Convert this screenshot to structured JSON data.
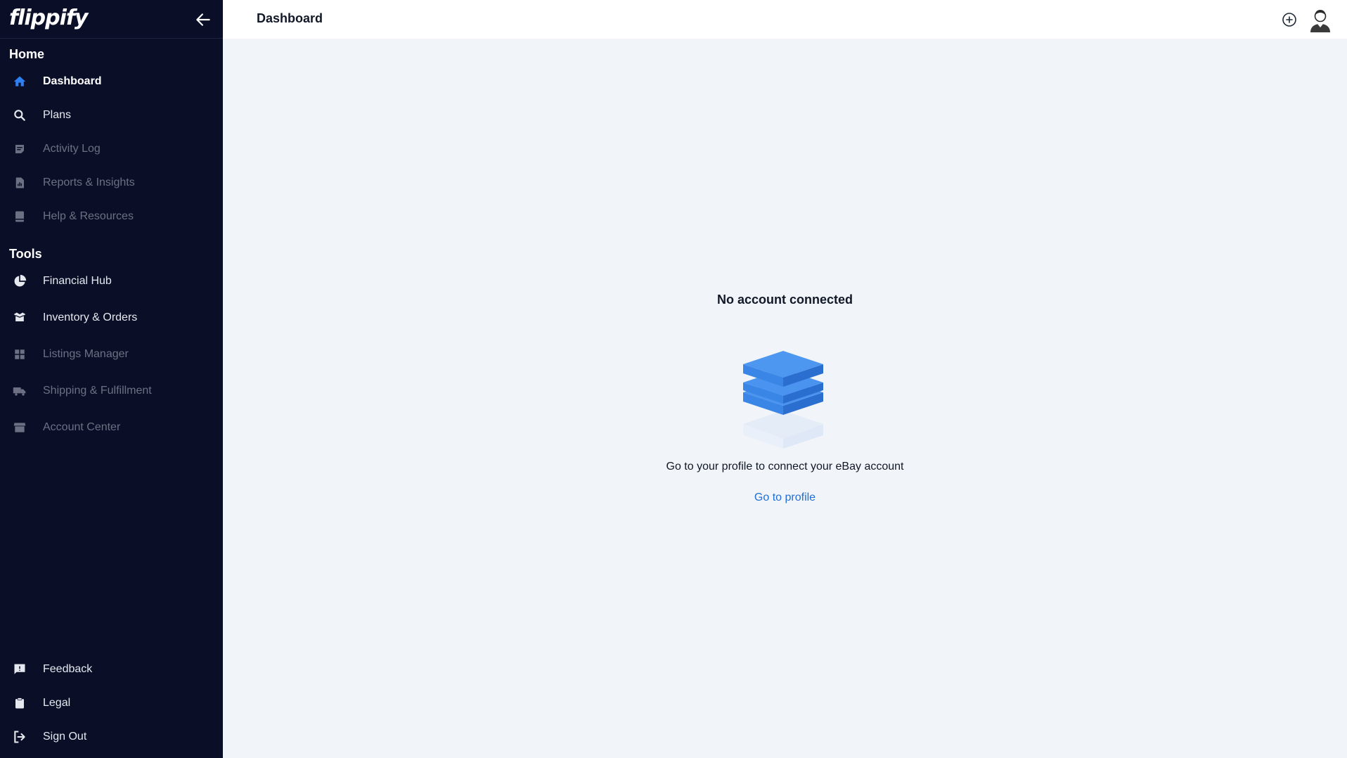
{
  "brand": {
    "logo_text": "flippify"
  },
  "sidebar": {
    "sections": {
      "home": "Home",
      "tools": "Tools"
    },
    "home_items": [
      {
        "label": "Dashboard",
        "icon": "home-icon",
        "state": "active"
      },
      {
        "label": "Plans",
        "icon": "search-icon",
        "state": "enabled"
      },
      {
        "label": "Activity Log",
        "icon": "note-icon",
        "state": "disabled"
      },
      {
        "label": "Reports & Insights",
        "icon": "report-icon",
        "state": "disabled"
      },
      {
        "label": "Help & Resources",
        "icon": "book-icon",
        "state": "disabled"
      }
    ],
    "tools_items": [
      {
        "label": "Financial Hub",
        "icon": "pie-chart-icon",
        "state": "enabled"
      },
      {
        "label": "Inventory & Orders",
        "icon": "box-icon",
        "state": "enabled"
      },
      {
        "label": "Listings Manager",
        "icon": "grid-icon",
        "state": "disabled"
      },
      {
        "label": "Shipping & Fulfillment",
        "icon": "truck-icon",
        "state": "disabled"
      },
      {
        "label": "Account Center",
        "icon": "store-icon",
        "state": "disabled"
      }
    ],
    "footer_items": [
      {
        "label": "Feedback",
        "icon": "feedback-icon"
      },
      {
        "label": "Legal",
        "icon": "clipboard-icon"
      },
      {
        "label": "Sign Out",
        "icon": "sign-out-icon"
      }
    ]
  },
  "header": {
    "title": "Dashboard"
  },
  "main": {
    "empty_title": "No account connected",
    "empty_text": "Go to your profile to connect your eBay account",
    "link_text": "Go to profile"
  },
  "colors": {
    "sidebar_bg": "#0a0e27",
    "accent": "#1f6fd6",
    "content_bg": "#f1f4f9"
  }
}
